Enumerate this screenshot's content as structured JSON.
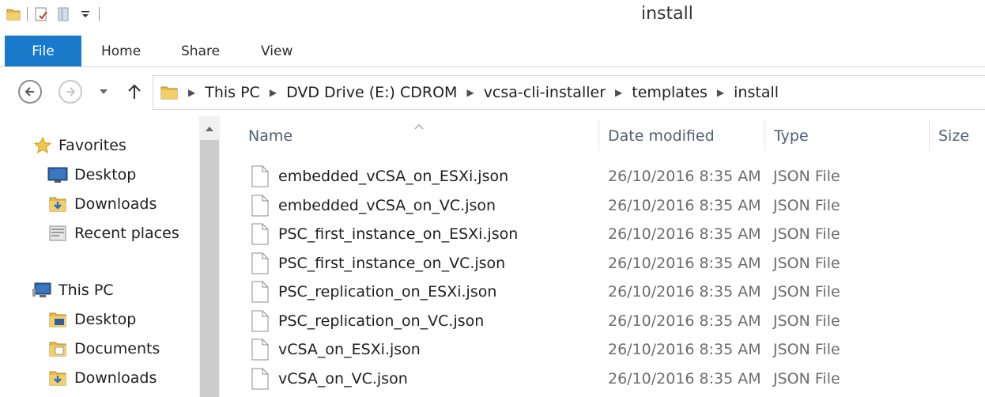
{
  "window": {
    "title": "install"
  },
  "quick_access": {
    "items": [
      "folder-icon",
      "properties-icon",
      "new-folder-icon",
      "customize-dropdown-icon"
    ]
  },
  "ribbon": {
    "tabs": [
      {
        "label": "File",
        "active": true
      },
      {
        "label": "Home"
      },
      {
        "label": "Share"
      },
      {
        "label": "View"
      }
    ]
  },
  "address": {
    "breadcrumbs": [
      "This PC",
      "DVD Drive (E:) CDROM",
      "vcsa-cli-installer",
      "templates",
      "install"
    ]
  },
  "navpane": {
    "favorites": {
      "label": "Favorites",
      "items": [
        {
          "label": "Desktop",
          "icon": "desktop-icon"
        },
        {
          "label": "Downloads",
          "icon": "downloads-folder-icon"
        },
        {
          "label": "Recent places",
          "icon": "recent-places-icon"
        }
      ]
    },
    "this_pc": {
      "label": "This PC",
      "items": [
        {
          "label": "Desktop",
          "icon": "desktop-folder-icon"
        },
        {
          "label": "Documents",
          "icon": "documents-folder-icon"
        },
        {
          "label": "Downloads",
          "icon": "downloads-folder-icon"
        }
      ]
    }
  },
  "filelist": {
    "columns": {
      "name": "Name",
      "date": "Date modified",
      "type": "Type",
      "size": "Size"
    },
    "files": [
      {
        "name": "embedded_vCSA_on_ESXi.json",
        "date": "26/10/2016 8:35 AM",
        "type": "JSON File"
      },
      {
        "name": "embedded_vCSA_on_VC.json",
        "date": "26/10/2016 8:35 AM",
        "type": "JSON File"
      },
      {
        "name": "PSC_first_instance_on_ESXi.json",
        "date": "26/10/2016 8:35 AM",
        "type": "JSON File"
      },
      {
        "name": "PSC_first_instance_on_VC.json",
        "date": "26/10/2016 8:35 AM",
        "type": "JSON File"
      },
      {
        "name": "PSC_replication_on_ESXi.json",
        "date": "26/10/2016 8:35 AM",
        "type": "JSON File"
      },
      {
        "name": "PSC_replication_on_VC.json",
        "date": "26/10/2016 8:35 AM",
        "type": "JSON File"
      },
      {
        "name": "vCSA_on_ESXi.json",
        "date": "26/10/2016 8:35 AM",
        "type": "JSON File"
      },
      {
        "name": "vCSA_on_VC.json",
        "date": "26/10/2016 8:35 AM",
        "type": "JSON File"
      }
    ]
  },
  "colors": {
    "file_tab": "#1979ca",
    "header_text": "#4c607a",
    "folder": "#e8b94a"
  }
}
